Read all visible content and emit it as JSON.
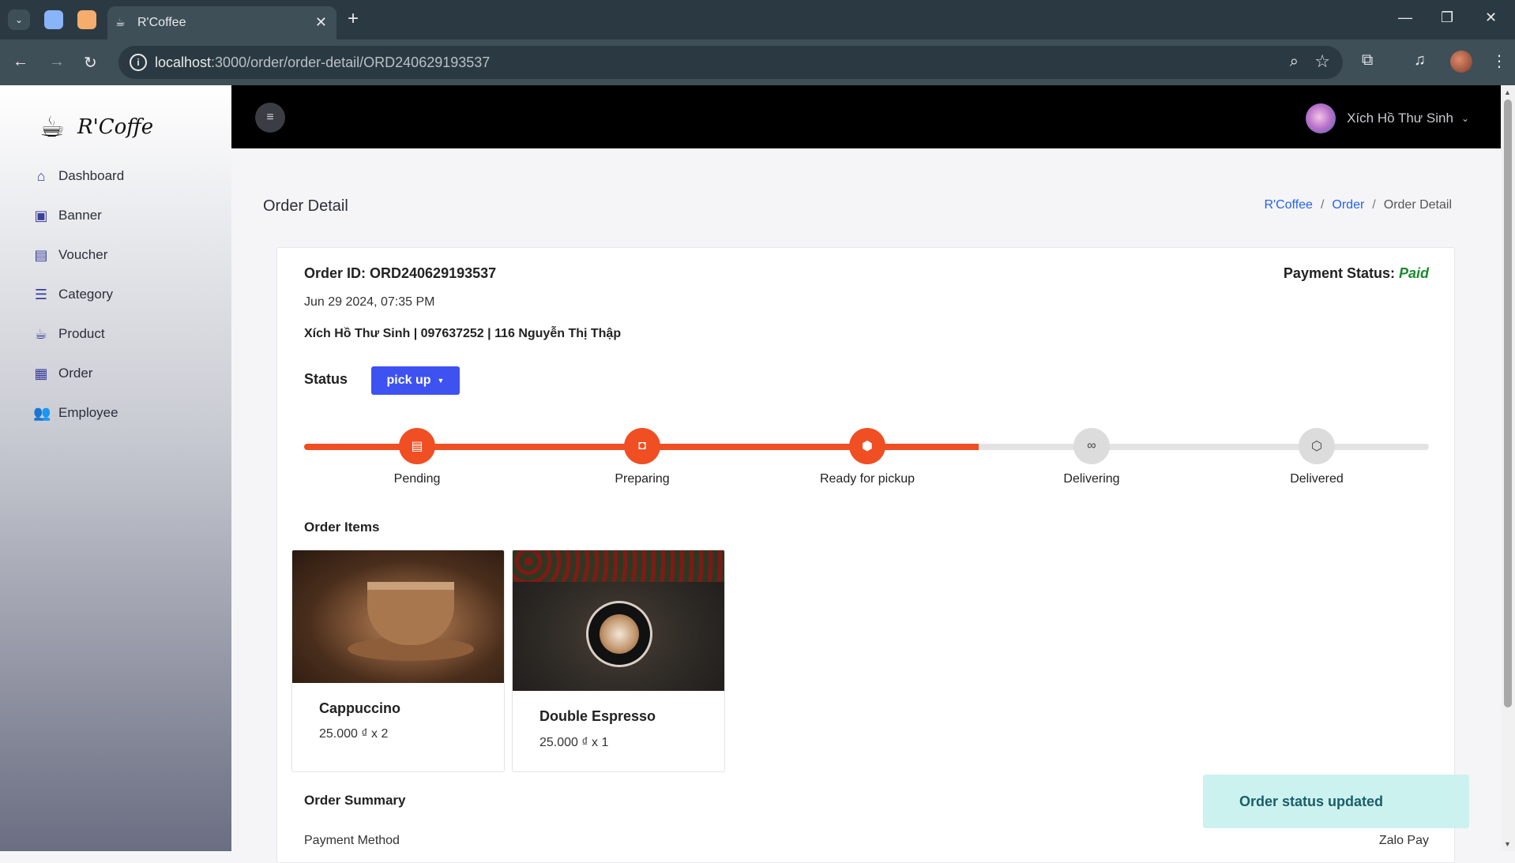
{
  "browser": {
    "tab_title": "R'Coffee",
    "url_host": "localhost",
    "url_path": ":3000/order/order-detail/ORD240629193537"
  },
  "sidebar": {
    "brand": "R'Coffe",
    "items": [
      {
        "label": "Dashboard",
        "icon": "home-icon"
      },
      {
        "label": "Banner",
        "icon": "image-icon"
      },
      {
        "label": "Voucher",
        "icon": "ticket-icon"
      },
      {
        "label": "Category",
        "icon": "list-icon"
      },
      {
        "label": "Product",
        "icon": "cup-icon"
      },
      {
        "label": "Order",
        "icon": "table-icon"
      },
      {
        "label": "Employee",
        "icon": "users-icon"
      }
    ]
  },
  "header": {
    "user_name": "Xích Hồ Thư Sinh"
  },
  "page": {
    "title": "Order Detail",
    "breadcrumb": [
      "R'Coffee",
      "Order",
      "Order Detail"
    ]
  },
  "order": {
    "id_text": "Order ID: ORD240629193537",
    "payment_label": "Payment Status:",
    "payment_value": "Paid",
    "date": "Jun 29 2024, 07:35 PM",
    "customer": "Xích Hồ Thư Sinh | 097637252 | 116 Nguyễn Thị Thập",
    "status_label": "Status",
    "status_value": "pick up",
    "progress_fraction": 0.6,
    "steps": [
      {
        "label": "Pending",
        "state": "done"
      },
      {
        "label": "Preparing",
        "state": "done"
      },
      {
        "label": "Ready for pickup",
        "state": "done"
      },
      {
        "label": "Delivering",
        "state": "todo"
      },
      {
        "label": "Delivered",
        "state": "todo"
      }
    ],
    "items_title": "Order Items",
    "items": [
      {
        "name": "Cappuccino",
        "price": "25.000 ₫ x 2"
      },
      {
        "name": "Double Espresso",
        "price": "25.000 ₫ x 1"
      }
    ],
    "summary_title": "Order Summary",
    "payment_method_label": "Payment Method",
    "payment_method_value": "Zalo Pay"
  },
  "toast": {
    "message": "Order status updated"
  },
  "colors": {
    "accent": "#f04e23",
    "primary_button": "#3d52f0",
    "paid": "#1a8a2e"
  }
}
